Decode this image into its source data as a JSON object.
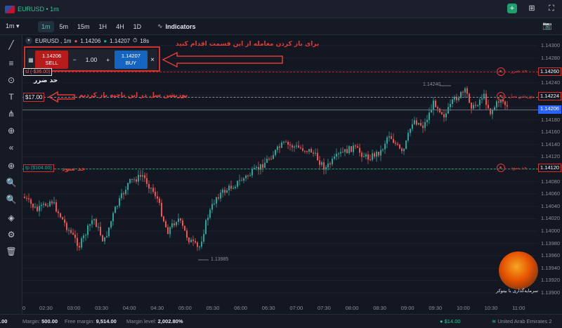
{
  "header": {
    "symbol_label": "EURUSD • 1m",
    "plus_icon": "plus-icon",
    "grid_icon": "grid-icon",
    "fullscreen_icon": "fullscreen-icon"
  },
  "toolbar": {
    "timeframe_select": "1m",
    "timeframes": [
      "1m",
      "5m",
      "15m",
      "1H",
      "4H",
      "1D"
    ],
    "active_timeframe": "1m",
    "indicators_label": "Indicators"
  },
  "symbol_info": {
    "text": "EURUSD , 1m",
    "bid": "1.14206",
    "ask": "1.14207",
    "timer": "18s"
  },
  "trade_panel": {
    "sell_price": "1.14206",
    "sell_label": "SELL",
    "quantity": "1.00",
    "minus": "−",
    "plus": "+",
    "buy_price": "1.14207",
    "buy_label": "BUY",
    "close": "×"
  },
  "orders": {
    "sl_tag": "sl (-$36.00)",
    "position_tag": "$17.00",
    "tp_tag": "tp ($104.00)"
  },
  "annotations": {
    "open_trade": "برای باز کردن معامله از این قسمت اقدام کنید",
    "stop_loss": "حد ضرر",
    "position": "پوزیشن سل در این ناحیه باز کردیم",
    "take_profit": "حد سود",
    "marker_stop_loss": "حد ضرر",
    "marker_position": "پوزیشن سل",
    "marker_take_profit": "حد سود"
  },
  "price_boxes": {
    "stop_loss": "1.14260",
    "position": "1.14224",
    "current": "1.14206",
    "take_profit": "1.14120"
  },
  "price_axis": [
    "1.14300",
    "1.14280",
    "1.14260",
    "1.14240",
    "1.14220",
    "1.14200",
    "1.14180",
    "1.14160",
    "1.14140",
    "1.14120",
    "1.14100",
    "1.14080",
    "1.14060",
    "1.14040",
    "1.14020",
    "1.14000",
    "1.13980",
    "1.13960",
    "1.13940",
    "1.13920",
    "1.13900"
  ],
  "time_axis": [
    "0",
    "02:30",
    "03:00",
    "03:30",
    "04:00",
    "04:30",
    "05:00",
    "05:30",
    "06:00",
    "06:30",
    "07:00",
    "07:30",
    "08:00",
    "08:30",
    "09:00",
    "09:30",
    "10:00",
    "10:30",
    "11:00"
  ],
  "chart_labels": {
    "high": "1.14240",
    "low": "1.13985"
  },
  "status_bar": {
    "balance_value": ".00",
    "margin_label": "Margin:",
    "margin_value": "500.00",
    "free_margin_label": "Free margin:",
    "free_margin_value": "9,514.00",
    "margin_level_label": "Margin level:",
    "margin_level_value": "2,002.80%",
    "pnl": "$14.00",
    "server": "United Arab Emirates 2"
  },
  "logo_text": "سرمایه‌گذاری با بیتوکر",
  "colors": {
    "background": "#131722",
    "bull": "#26a69a",
    "bear": "#ef5350",
    "annotation_red": "#e53935",
    "accent_green": "#20c997",
    "current_price": "#2962ff"
  }
}
